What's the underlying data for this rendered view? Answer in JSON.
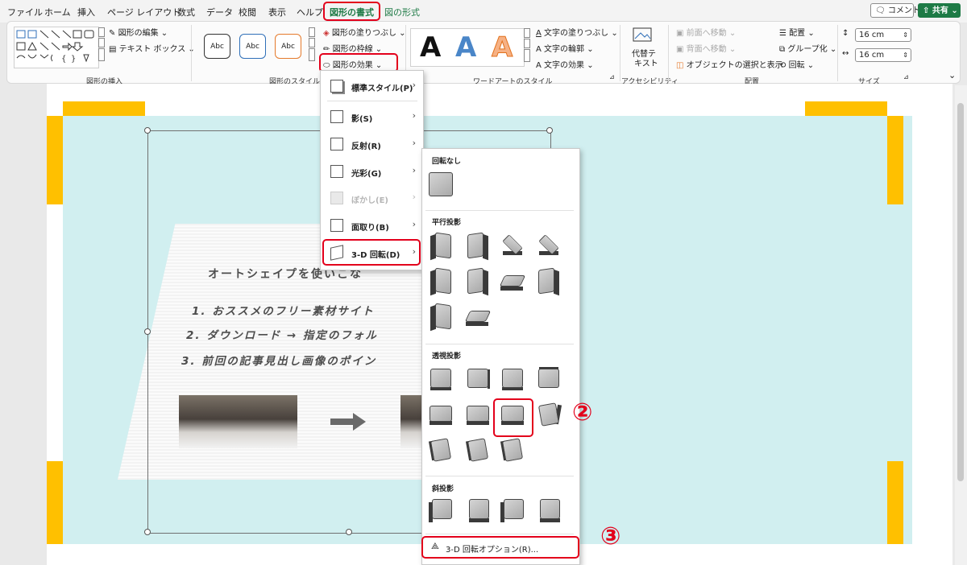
{
  "menubar": {
    "tabs": [
      "ファイル",
      "ホーム",
      "挿入",
      "ページ レイアウト",
      "数式",
      "データ",
      "校閲",
      "表示",
      "ヘルプ",
      "図形の書式",
      "図の形式"
    ],
    "comment_label": "コメント",
    "share_label": "共有"
  },
  "ribbon": {
    "insert_shapes": {
      "label": "図形の挿入",
      "edit_shape": "図形の編集",
      "text_box": "テキスト ボックス"
    },
    "shape_styles": {
      "label": "図形のスタイル",
      "thumb_text": "Abc",
      "fill": "図形の塗りつぶし",
      "outline": "図形の枠線",
      "effects": "図形の効果"
    },
    "wordart": {
      "label": "ワードアートのスタイル",
      "letter": "A",
      "text_fill": "文字の塗りつぶし",
      "text_outline": "文字の輪郭",
      "text_effects": "文字の効果"
    },
    "accessibility": {
      "label": "アクセシビリティ",
      "alt_text_l1": "代替テ",
      "alt_text_l2": "キスト"
    },
    "arrange": {
      "label": "配置",
      "bring_forward": "前面へ移動",
      "send_backward": "背面へ移動",
      "selection_pane": "オブジェクトの選択と表示",
      "align": "配置",
      "group": "グループ化",
      "rotate": "回転"
    },
    "size": {
      "label": "サイズ",
      "height": "16 cm",
      "width": "16 cm"
    }
  },
  "document": {
    "title": "オートシェイプを使いこな",
    "line1": "1. おススメのフリー素材サイト",
    "line2": "2. ダウンロード → 指定のフォル",
    "line3": "3. 前回の記事見出し画像のポイン"
  },
  "effects_menu": {
    "items": [
      {
        "label": "標準スタイル(P)"
      },
      {
        "label": "影(S)"
      },
      {
        "label": "反射(R)"
      },
      {
        "label": "光彩(G)"
      },
      {
        "label": "ぼかし(E)"
      },
      {
        "label": "面取り(B)"
      },
      {
        "label": "3-D 回転(D)"
      }
    ]
  },
  "rotation_menu": {
    "no_rotation": "回転なし",
    "parallel": "平行投影",
    "perspective": "透視投影",
    "oblique": "斜投影",
    "options": "3-D 回転オプション(R)..."
  },
  "callouts": {
    "step2": "②",
    "step3": "③"
  },
  "colors": {
    "accent_green": "#1d7a45",
    "highlight_red": "#e3001b",
    "frame_yellow": "#ffc000",
    "slide_cyan": "#d1eff0"
  }
}
